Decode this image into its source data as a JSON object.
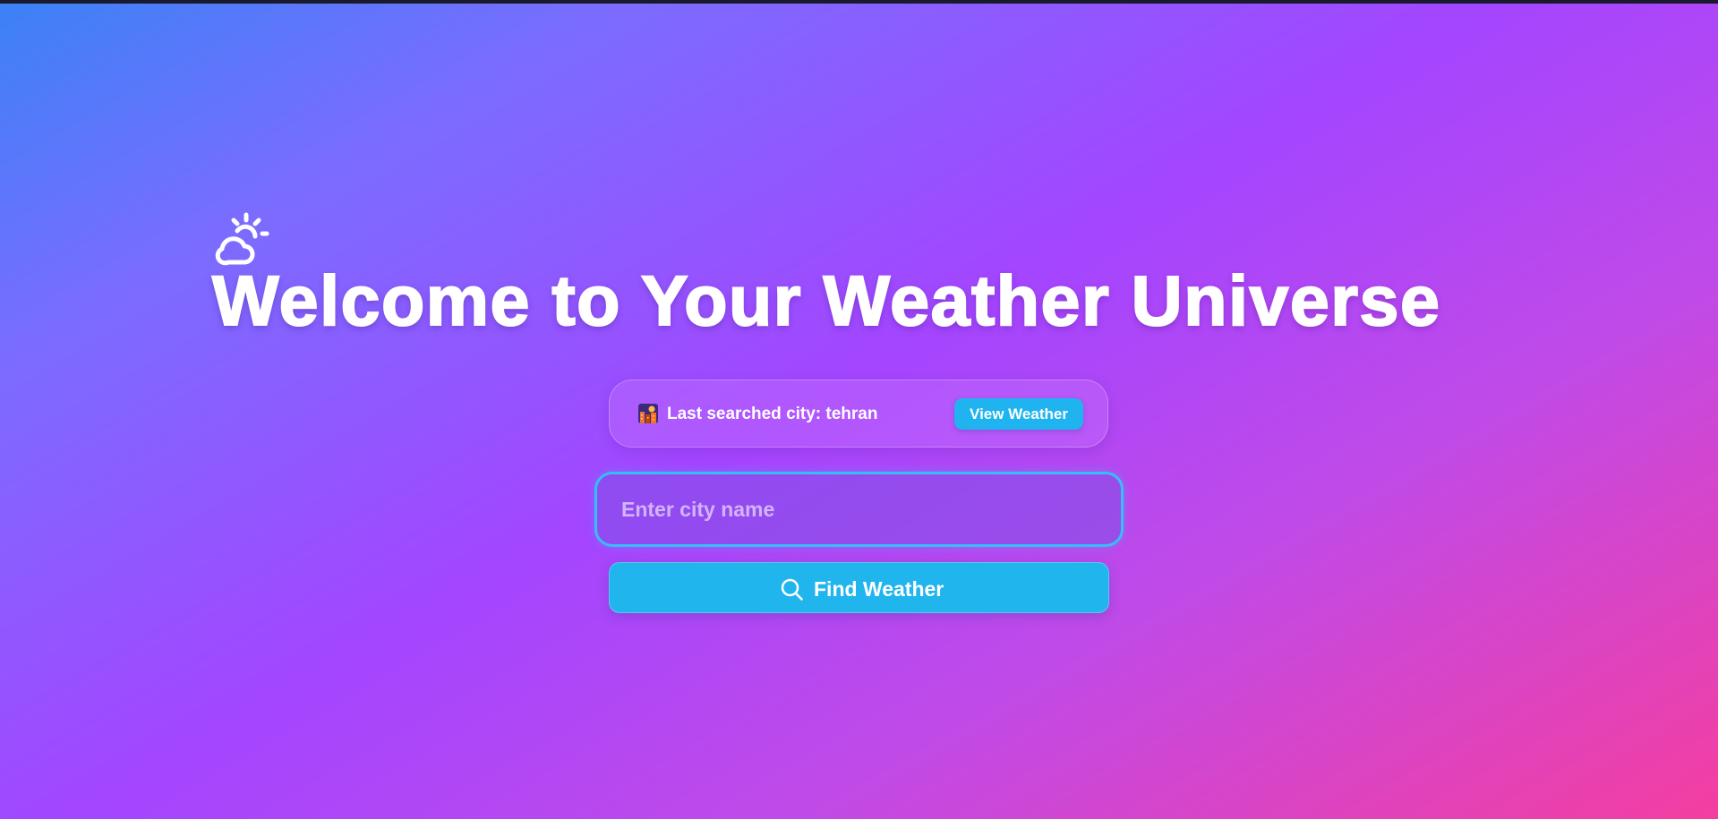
{
  "hero": {
    "icon": "cloud-sun-icon",
    "title": "Welcome to Your Weather Universe"
  },
  "last_search": {
    "icon": "city-night-emoji",
    "text": "Last searched city: tehran",
    "button_label": "View Weather"
  },
  "search": {
    "placeholder": "Enter city name",
    "value": "",
    "button_label": "Find Weather",
    "button_icon": "search-icon"
  },
  "colors": {
    "accent": "#38bdf8",
    "button": "#21b5ee",
    "gradient_start": "#3b82f6",
    "gradient_mid": "#a445ff",
    "gradient_end": "#f43ea0"
  }
}
